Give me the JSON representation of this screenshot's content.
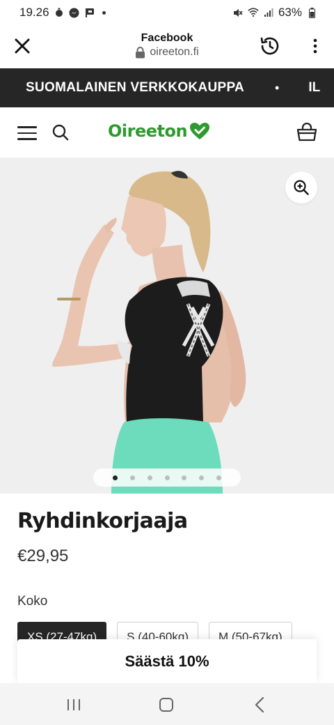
{
  "status_bar": {
    "time": "19.26",
    "battery": "63%"
  },
  "browser": {
    "title": "Facebook",
    "url": "oireeton.fi"
  },
  "marquee": {
    "text": "SUOMALAINEN VERKKOKAUPPA",
    "separator": "•",
    "next_text": "IL"
  },
  "shop_header": {
    "logo_text": "Oireeton",
    "brand_color": "#2e9a2e"
  },
  "gallery": {
    "slide_count": 7,
    "active_slide": 1
  },
  "product": {
    "title": "Ryhdinkorjaaja",
    "price": "€29,95",
    "size_label": "Koko",
    "sizes": [
      {
        "label": "XS (27-47kg)",
        "selected": true
      },
      {
        "label": "S (40-60kg)",
        "selected": false
      },
      {
        "label": "M (50-67kg)",
        "selected": false
      }
    ]
  },
  "save_banner": {
    "text": "Säästä 10%"
  }
}
